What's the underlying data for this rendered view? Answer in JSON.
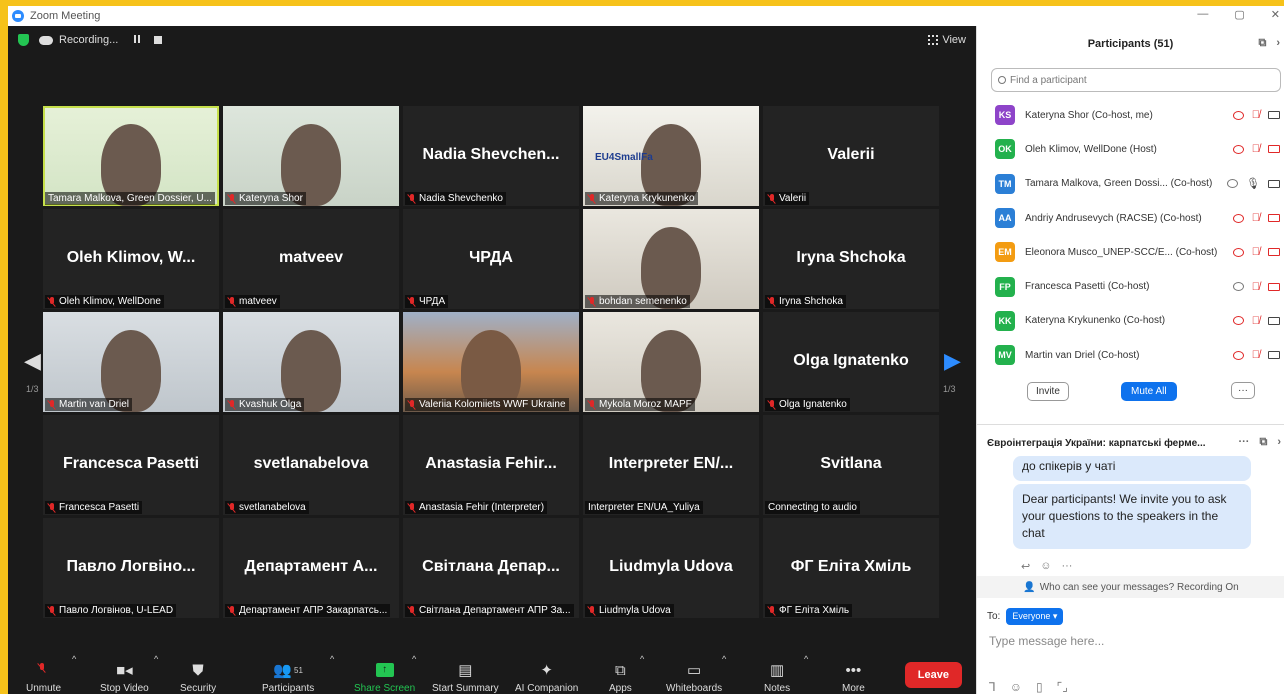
{
  "window": {
    "title": "Zoom Meeting"
  },
  "topbar": {
    "recording_label": "Recording...",
    "view_label": "View"
  },
  "nav": {
    "page_left": "1/3",
    "page_right": "1/3"
  },
  "tiles": [
    {
      "id": "t1",
      "big": "",
      "label": "Tamara Malkova, Green Dossier, U...",
      "video": "vid-a",
      "muted": false,
      "active": true
    },
    {
      "id": "t2",
      "big": "",
      "label": "Kateryna Shor",
      "video": "vid-b",
      "muted": true
    },
    {
      "id": "t3",
      "big": "Nadia  Shevchen...",
      "label": "Nadia Shevchenko",
      "video": "",
      "muted": true
    },
    {
      "id": "t4",
      "big": "",
      "label": "Kateryna Krykunenko",
      "video": "vid-c",
      "muted": true,
      "banner": "EU4SmallFa"
    },
    {
      "id": "t5",
      "big": "Valerii",
      "label": "Valerii",
      "video": "",
      "muted": true
    },
    {
      "id": "t6",
      "big": "Oleh  Klimov,  W...",
      "label": "Oleh Klimov, WellDone",
      "video": "",
      "muted": true
    },
    {
      "id": "t7",
      "big": "matveev",
      "label": "matveev",
      "video": "",
      "muted": true
    },
    {
      "id": "t8",
      "big": "ЧРДА",
      "label": "ЧРДА",
      "video": "",
      "muted": true
    },
    {
      "id": "t9",
      "big": "",
      "label": "bohdan semenenko",
      "video": "vid-f",
      "muted": true
    },
    {
      "id": "t10",
      "big": "Iryna Shchoka",
      "label": "Iryna Shchoka",
      "video": "",
      "muted": true
    },
    {
      "id": "t11",
      "big": "",
      "label": "Martin van Driel",
      "video": "vid-d",
      "muted": true
    },
    {
      "id": "t12",
      "big": "",
      "label": "Kvashuk Olga",
      "video": "vid-d",
      "muted": true
    },
    {
      "id": "t13",
      "big": "",
      "label": "Valeriia Kolomiiets WWF Ukraine",
      "video": "vid-e",
      "muted": true
    },
    {
      "id": "t14",
      "big": "",
      "label": "Mykola Moroz MAPF",
      "video": "vid-f",
      "muted": true
    },
    {
      "id": "t15",
      "big": "Olga Ignatenko",
      "label": "Olga Ignatenko",
      "video": "",
      "muted": true
    },
    {
      "id": "t16",
      "big": "Francesca Pasetti",
      "label": "Francesca Pasetti",
      "video": "",
      "muted": true
    },
    {
      "id": "t17",
      "big": "svetlanabelova",
      "label": "svetlanabelova",
      "video": "",
      "muted": true
    },
    {
      "id": "t18",
      "big": "Anastasia  Fehir...",
      "label": "Anastasia Fehir (Interpreter)",
      "video": "",
      "muted": true
    },
    {
      "id": "t19",
      "big": "Interpreter  EN/...",
      "label": "Interpreter EN/UA_Yuliya",
      "video": "",
      "muted": false
    },
    {
      "id": "t20",
      "big": "Svitlana",
      "label": "Connecting to audio",
      "video": "",
      "muted": false
    },
    {
      "id": "t21",
      "big": "Павло  Логвіно...",
      "label": "Павло Логвінов, U-LEAD",
      "video": "",
      "muted": true
    },
    {
      "id": "t22",
      "big": "Департамент  А...",
      "label": "Департамент АПР Закарпатсь...",
      "video": "",
      "muted": true
    },
    {
      "id": "t23",
      "big": "Світлана  Депар...",
      "label": "Світлана Департамент АПР За...",
      "video": "",
      "muted": true
    },
    {
      "id": "t24",
      "big": "Liudmyla Udova",
      "label": "Liudmyla Udova",
      "video": "",
      "muted": true
    },
    {
      "id": "t25",
      "big": "ФГ Еліта Хміль",
      "label": "ФГ Еліта Хміль",
      "video": "",
      "muted": true
    }
  ],
  "toolbar": {
    "unmute": "Unmute",
    "stop_video": "Stop Video",
    "security": "Security",
    "participants": "Participants",
    "participants_count": "51",
    "share_screen": "Share Screen",
    "start_summary": "Start Summary",
    "ai_companion": "AI Companion",
    "apps": "Apps",
    "whiteboards": "Whiteboards",
    "notes": "Notes",
    "more": "More",
    "leave": "Leave"
  },
  "panel": {
    "title": "Participants (51)",
    "search_placeholder": "Find a participant",
    "participants": [
      {
        "initials": "KS",
        "name": "Kateryna Shor (Co-host, me)",
        "color": "#8e44c9",
        "share_red": true,
        "mic_on": false,
        "cam_off": false
      },
      {
        "initials": "OK",
        "name": "Oleh Klimov, WellDone (Host)",
        "color": "#23b14d",
        "share_red": true,
        "mic_on": false,
        "cam_off": true
      },
      {
        "initials": "TM",
        "name": "Tamara Malkova, Green Dossi...  (Co-host)",
        "color": "#2b7fd6",
        "share_red": false,
        "mic_on": true,
        "cam_off": false
      },
      {
        "initials": "AA",
        "name": "Andriy Andrusevych (RACSE) (Co-host)",
        "color": "#2b7fd6",
        "share_red": true,
        "mic_on": false,
        "cam_off": true
      },
      {
        "initials": "EM",
        "name": "Eleonora Musco_UNEP-SCC/E...  (Co-host)",
        "color": "#f39c12",
        "share_red": true,
        "mic_on": false,
        "cam_off": true
      },
      {
        "initials": "FP",
        "name": "Francesca Pasetti (Co-host)",
        "color": "#23b14d",
        "share_red": false,
        "mic_on": false,
        "cam_off": true
      },
      {
        "initials": "KK",
        "name": "Kateryna Krykunenko (Co-host)",
        "color": "#23b14d",
        "share_red": true,
        "mic_on": false,
        "cam_off": false
      },
      {
        "initials": "MV",
        "name": "Martin van Driel (Co-host)",
        "color": "#23b14d",
        "share_red": true,
        "mic_on": false,
        "cam_off": false
      }
    ],
    "invite": "Invite",
    "mute_all": "Mute All",
    "more": "···"
  },
  "chat": {
    "title": "Євроінтеграція України: карпатські ферме...",
    "msg1": "до спікерів у чаті",
    "msg2": "Dear participants! We invite you to ask your questions to the speakers in the chat",
    "who_can_see": "Who can see your messages? Recording On",
    "to_label": "To:",
    "to_target": "Everyone",
    "input_placeholder": "Type message here..."
  }
}
